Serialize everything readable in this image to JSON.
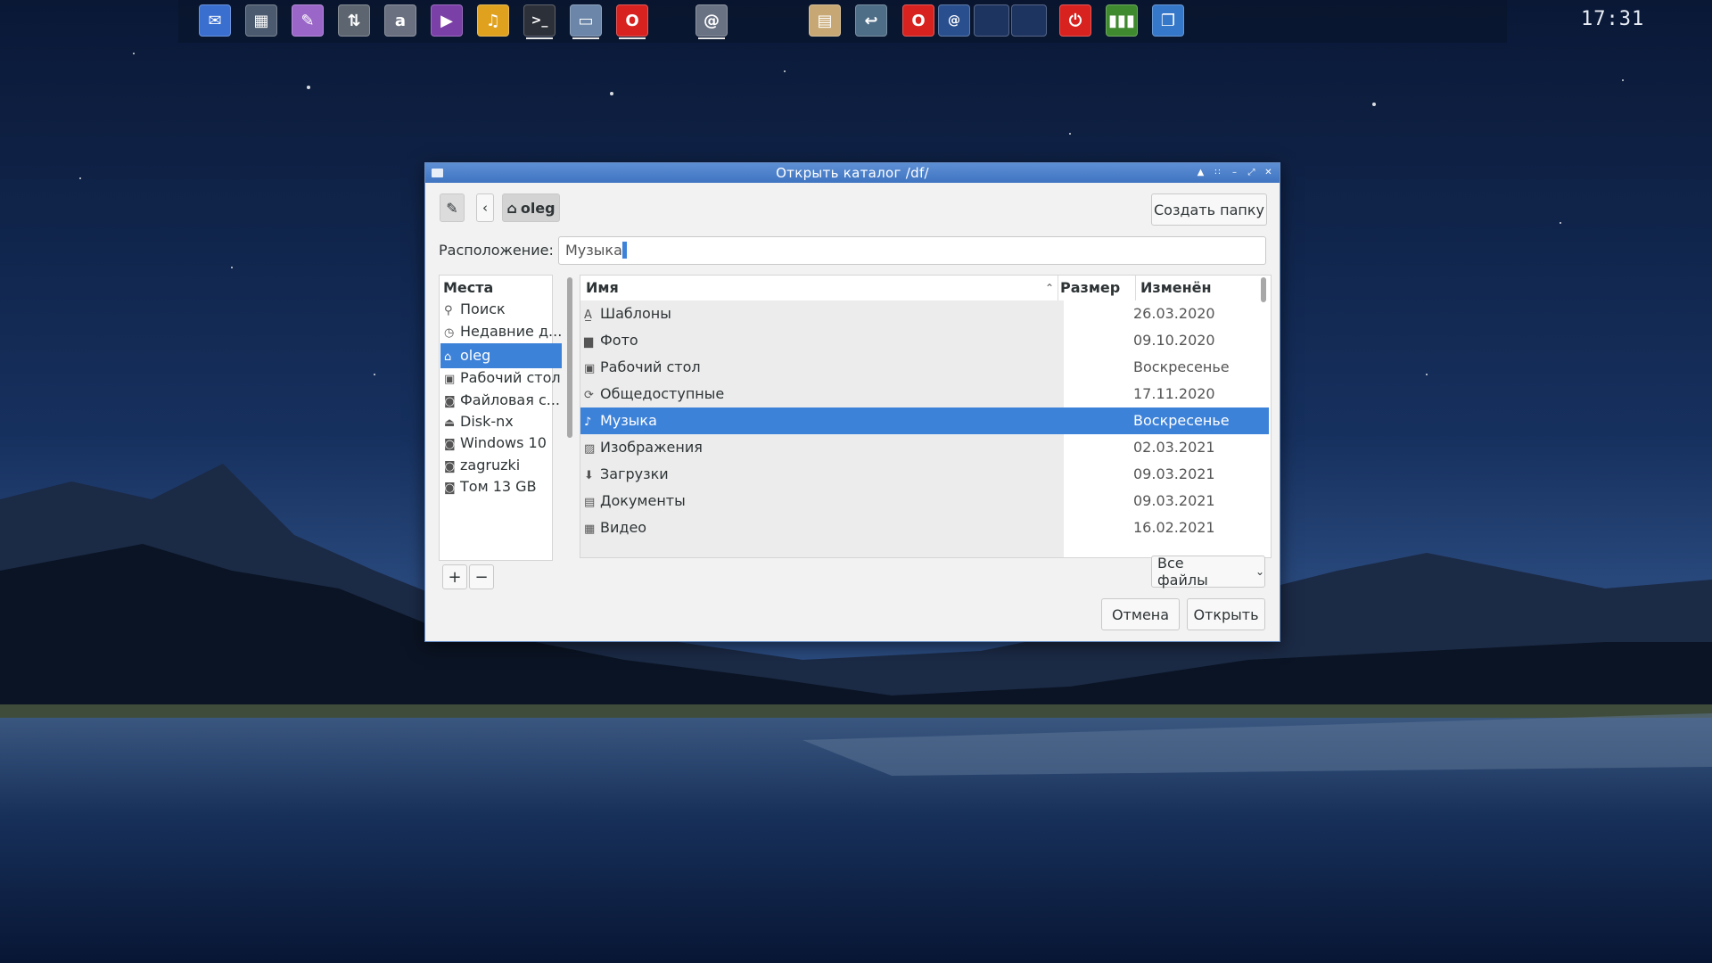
{
  "panel": {
    "launchers": [
      {
        "icon": "messenger-apps-icon",
        "color": "#3a6fd0"
      },
      {
        "icon": "calculator-icon",
        "color": "#4b5a6e"
      },
      {
        "icon": "paint-palette-icon",
        "color": "#9a66c8"
      },
      {
        "icon": "transfer-arrows-icon",
        "color": "#5d6670"
      },
      {
        "icon": "at-sign-icon",
        "color": "#6a7080"
      },
      {
        "icon": "media-player-icon",
        "color": "#7b3fa8"
      },
      {
        "icon": "audio-equalizer-icon",
        "color": "#e0a21e"
      },
      {
        "icon": "terminal-icon",
        "color": "#2c3038"
      },
      {
        "icon": "file-manager-icon",
        "color": "#6b86a8"
      },
      {
        "icon": "opera-browser-icon",
        "color": "#d8221f"
      },
      {
        "icon": "mail-client-icon",
        "color": "#697283"
      },
      {
        "icon": "clipboard-icon",
        "color": "#c7a875"
      },
      {
        "icon": "back-arrow-icon",
        "color": "#4e6d86"
      },
      {
        "icon": "opera-task-icon",
        "color": "#d8221f"
      },
      {
        "icon": "email-task-icon",
        "color": "#2a4f8e"
      },
      {
        "icon": "desktop-1-thumbnail-icon",
        "color": "#1d3360"
      },
      {
        "icon": "desktop-2-thumbnail-icon",
        "color": "#1d3360"
      },
      {
        "icon": "power-icon",
        "color": "#d8221f"
      },
      {
        "icon": "system-monitor-icon",
        "color": "#3f8a2e"
      },
      {
        "icon": "window-list-icon",
        "color": "#3577c9"
      }
    ],
    "clock": "17:31"
  },
  "dialog": {
    "title": "Открыть каталог   /df/",
    "path_button": "oleg",
    "create_folder_label": "Создать папку",
    "location_label": "Расположение:",
    "location_value": "Музыка",
    "location_selected": "/",
    "places": {
      "header": "Места",
      "items": [
        {
          "label": "Поиск",
          "icon": "search-icon"
        },
        {
          "label": "Недавние д...",
          "icon": "clock-icon"
        },
        {
          "label": "oleg",
          "icon": "home-icon",
          "selected": true
        },
        {
          "label": "Рабочий стол",
          "icon": "desktop-icon"
        },
        {
          "label": "Файловая с...",
          "icon": "drive-icon"
        },
        {
          "label": "Disk-nx",
          "icon": "eject-drive-icon"
        },
        {
          "label": "Windows 10",
          "icon": "drive-icon"
        },
        {
          "label": "zagruzki",
          "icon": "drive-icon"
        },
        {
          "label": "Том 13 GB",
          "icon": "drive-icon"
        }
      ],
      "add_label": "+",
      "remove_label": "−"
    },
    "columns": {
      "name": "Имя",
      "size": "Размер",
      "modified": "Изменён"
    },
    "files": [
      {
        "name": "Шаблоны",
        "modified": "26.03.2020",
        "icon": "templates-folder-icon"
      },
      {
        "name": "Фото",
        "modified": "09.10.2020",
        "icon": "folder-icon"
      },
      {
        "name": "Рабочий стол",
        "modified": "Воскресенье",
        "icon": "desktop-folder-icon"
      },
      {
        "name": "Общедоступные",
        "modified": "17.11.2020",
        "icon": "share-folder-icon"
      },
      {
        "name": "Музыка",
        "modified": "Воскресенье",
        "icon": "music-folder-icon",
        "selected": true
      },
      {
        "name": "Изображения",
        "modified": "02.03.2021",
        "icon": "pictures-folder-icon"
      },
      {
        "name": "Загрузки",
        "modified": "09.03.2021",
        "icon": "downloads-folder-icon"
      },
      {
        "name": "Документы",
        "modified": "09.03.2021",
        "icon": "documents-folder-icon"
      },
      {
        "name": "Видео",
        "modified": "16.02.2021",
        "icon": "video-folder-icon"
      }
    ],
    "filter_label": "Все файлы",
    "cancel_label": "Отмена",
    "open_label": "Открыть"
  },
  "colors": {
    "accent": "#3d82d9",
    "titlebar": "#4a7fc8",
    "dialog_bg": "#f2f2f2"
  }
}
